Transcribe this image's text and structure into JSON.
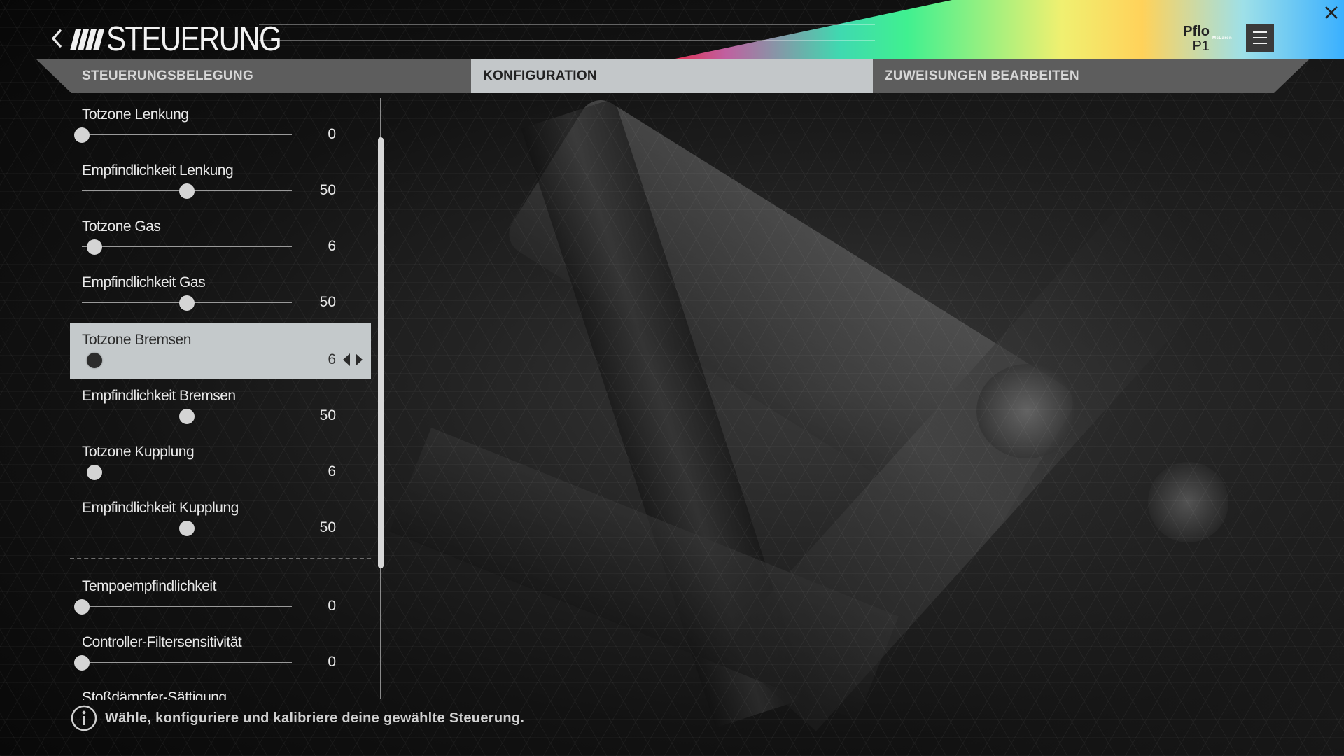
{
  "header": {
    "title": "STEUERUNG",
    "user_name": "Pflo",
    "user_rank": "P1",
    "manufacturer_logo_text": "McLaren"
  },
  "tabs": [
    {
      "label": "STEUERUNGSBELEGUNG",
      "active": false
    },
    {
      "label": "KONFIGURATION",
      "active": true
    },
    {
      "label": "ZUWEISUNGEN BEARBEITEN",
      "active": false
    }
  ],
  "settings": [
    {
      "label": "Totzone Lenkung",
      "value": 0,
      "max": 100
    },
    {
      "label": "Empfindlichkeit Lenkung",
      "value": 50,
      "max": 100
    },
    {
      "label": "Totzone Gas",
      "value": 6,
      "max": 100
    },
    {
      "label": "Empfindlichkeit Gas",
      "value": 50,
      "max": 100
    },
    {
      "label": "Totzone Bremsen",
      "value": 6,
      "max": 100,
      "selected": true
    },
    {
      "label": "Empfindlichkeit Bremsen",
      "value": 50,
      "max": 100
    },
    {
      "label": "Totzone Kupplung",
      "value": 6,
      "max": 100
    },
    {
      "label": "Empfindlichkeit Kupplung",
      "value": 50,
      "max": 100
    },
    {
      "label": "Tempoempfindlichkeit",
      "value": 0,
      "max": 100
    },
    {
      "label": "Controller-Filtersensitivität",
      "value": 0,
      "max": 100
    }
  ],
  "partial_setting_label": "Stoßdämpfer-Sättigung",
  "footer": {
    "hint": "Wähle, konfiguriere und kalibriere deine gewählte Steuerung."
  },
  "colors": {
    "selected_row": "#c4c9cb",
    "active_tab": "#c3c7c9",
    "tab_strip": "#5d5d5d"
  },
  "icons": {
    "back": "chevron-left-icon",
    "menu": "hamburger-menu-icon",
    "close": "close-icon",
    "info": "info-icon"
  }
}
